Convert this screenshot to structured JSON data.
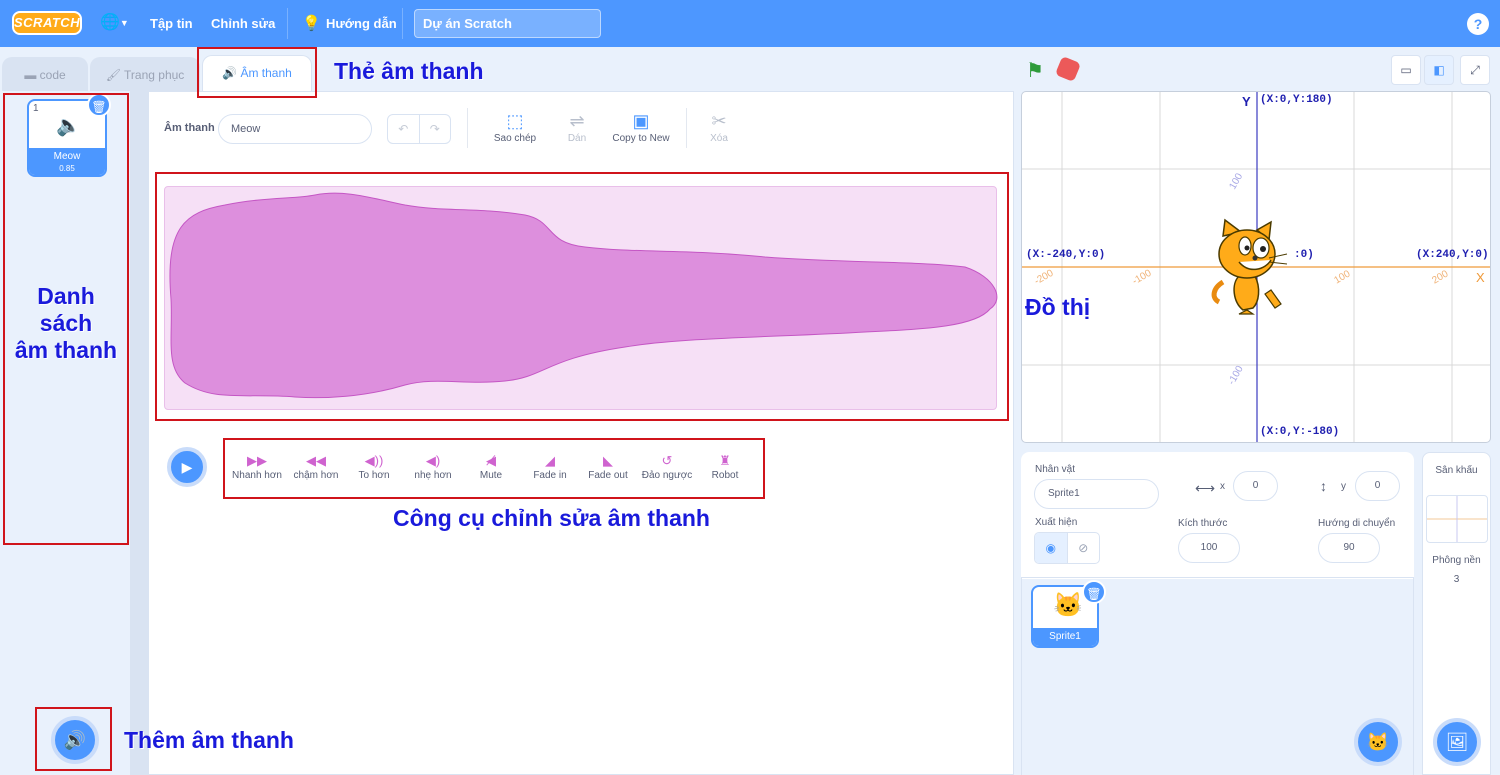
{
  "menubar": {
    "logo": "SCRATCH",
    "file": "Tập tin",
    "edit": "Chỉnh sửa",
    "tutorials": "Hướng dẫn",
    "project_title": "Dự án Scratch",
    "help": "?"
  },
  "tabs": [
    {
      "label": "code"
    },
    {
      "label": "Trang phục"
    },
    {
      "label": "Âm thanh"
    }
  ],
  "sound_list": {
    "items": [
      {
        "index": "1",
        "name": "Meow",
        "duration": "0.85"
      }
    ]
  },
  "editor": {
    "sound_label": "Âm thanh",
    "sound_name": "Meow",
    "tools": {
      "copy": "Sao chép",
      "paste": "Dán",
      "copy_to_new": "Copy to New",
      "delete": "Xóa"
    },
    "effects": [
      {
        "label": "Nhanh hơn",
        "icon": "faster-icon"
      },
      {
        "label": "chậm hơn",
        "icon": "slower-icon"
      },
      {
        "label": "To hơn",
        "icon": "louder-icon"
      },
      {
        "label": "nhẹ hơn",
        "icon": "softer-icon"
      },
      {
        "label": "Mute",
        "icon": "mute-icon"
      },
      {
        "label": "Fade in",
        "icon": "fade-in-icon"
      },
      {
        "label": "Fade out",
        "icon": "fade-out-icon"
      },
      {
        "label": "Đảo ngược",
        "icon": "reverse-icon"
      },
      {
        "label": "Robot",
        "icon": "robot-icon"
      }
    ]
  },
  "stage": {
    "top": "(X:0,Y:180)",
    "bottom": "(X:0,Y:-180)",
    "left": "(X:-240,Y:0)",
    "right": "(X:240,Y:0)",
    "center": ":0)",
    "axis_x": "X",
    "axis_y": "Y",
    "ticks_x": [
      "-200",
      "-100",
      "100",
      "200"
    ],
    "ticks_y": [
      "100",
      "-100"
    ]
  },
  "sprite_info": {
    "sprite_label": "Nhân vật",
    "sprite_name": "Sprite1",
    "x_label": "x",
    "x_value": "0",
    "y_label": "y",
    "y_value": "0",
    "show_label": "Xuất hiện",
    "size_label": "Kích thước",
    "size_value": "100",
    "direction_label": "Hướng di chuyển",
    "direction_value": "90"
  },
  "sprites": [
    {
      "name": "Sprite1"
    }
  ],
  "stage_pane": {
    "title": "Sân khấu",
    "backdrops_label": "Phông nền",
    "backdrops_count": "3"
  },
  "annotations": {
    "sound_tab": "Thẻ âm thanh",
    "sound_list": [
      "Danh",
      "sách",
      "âm thanh"
    ],
    "stage": "Đồ thị",
    "tools": "Công cụ chỉnh sửa âm thanh",
    "add_sound": "Thêm âm thanh"
  },
  "colors": {
    "menubar": "#4d97ff",
    "accent": "#4c97ff",
    "waveform": "#cf63cf",
    "annotation_box": "#d0141b",
    "annotation_text": "#1a1adb"
  }
}
